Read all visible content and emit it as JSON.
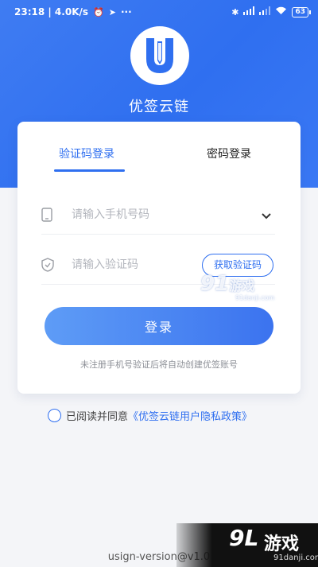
{
  "status_bar": {
    "time_speed": "23:18 | 4.0K/s",
    "more": "···",
    "battery": "63"
  },
  "app": {
    "title": "优签云链"
  },
  "tabs": [
    {
      "label": "验证码登录",
      "active": true
    },
    {
      "label": "密码登录",
      "active": false
    }
  ],
  "form": {
    "phone_placeholder": "请输入手机号码",
    "code_placeholder": "请输入验证码",
    "get_code_label": "获取验证码",
    "login_label": "登录",
    "hint": "未注册手机号验证后将自动创建优签账号"
  },
  "agreement": {
    "text": "已阅读并同意",
    "link": "《优签云链用户隐私政策》"
  },
  "version": "usign-version@v1.0",
  "watermark": {
    "mid_num": "91",
    "mid_text": "游戏",
    "mid_sub": "91danji.com",
    "bottom_num": "9L",
    "bottom_text": "游戏",
    "bottom_sub": "91danji.com"
  },
  "colors": {
    "accent": "#2f6ff0",
    "hero": "#3a78f4",
    "background": "#f4f5f8"
  }
}
